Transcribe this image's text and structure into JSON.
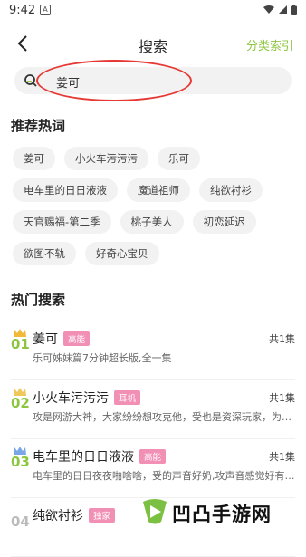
{
  "status_bar": {
    "time": "9:42",
    "icons": [
      "a-notification-icon",
      "wifi-icon",
      "signal-icon",
      "battery-icon"
    ]
  },
  "header": {
    "title": "搜索",
    "category_index": "分类索引"
  },
  "search": {
    "value": "姜可"
  },
  "recommended": {
    "title": "推荐热词",
    "tags": [
      "姜可",
      "小火车污污污",
      "乐可",
      "电车里的日日液液",
      "魔道祖师",
      "纯欲衬衫",
      "天官赐福-第二季",
      "桃子美人",
      "初恋延迟",
      "欲图不轨",
      "好奇心宝贝"
    ]
  },
  "hot": {
    "title": "热门搜索",
    "items": [
      {
        "rank": "01",
        "title": "姜可",
        "badge": "高能",
        "count": "共1集",
        "desc": "乐可姊妹篇7分钟超长版,全一集",
        "crown_color": "#f0b93a",
        "rank_color": "#8cc63f"
      },
      {
        "rank": "02",
        "title": "小火车污污污",
        "badge": "耳机",
        "count": "共1集",
        "desc": "攻是网游大神，大家纷纷想攻克他，受也是资深玩家，为了...",
        "crown_color": "#f0c85a",
        "rank_color": "#8cc63f"
      },
      {
        "rank": "03",
        "title": "电车里的日日液液",
        "badge": "高能",
        "count": "共1集",
        "desc": "电车里的日日夜夜啪啥啥，受的声音好奶,攻声音感觉好有磁性",
        "crown_color": "#7aa7e6",
        "rank_color": "#8cc63f"
      },
      {
        "rank": "04",
        "title": "纯欲衬衫",
        "badge": "独家",
        "count": "",
        "desc": "",
        "crown_color": "#cccccc",
        "rank_color": "#bbbbbb"
      }
    ]
  },
  "watermark": {
    "text": "凹凸手游网"
  },
  "colors": {
    "accent": "#8cc63f",
    "badge": "#f28fb5",
    "annotation": "#e53935"
  }
}
